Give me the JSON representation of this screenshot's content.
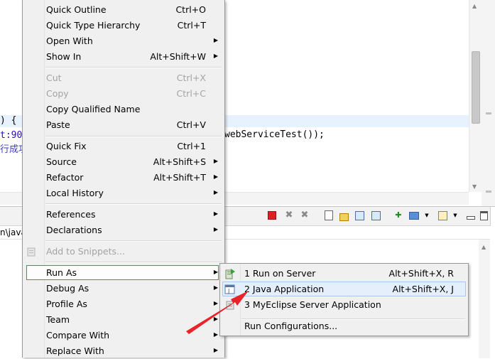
{
  "editor": {
    "code_lines": [
      {
        "text": ") {",
        "color": "#000000"
      },
      {
        "text": "t:90",
        "color": "#2a00ff"
      },
      {
        "text": "行成功",
        "color": "#3f3fbf"
      },
      {
        "text": "webServiceTest());",
        "color": "#000000"
      }
    ]
  },
  "console": {
    "path_text": "n\\java"
  },
  "context_menu": {
    "items": [
      {
        "label": "Quick Outline",
        "shortcut": "Ctrl+O",
        "submenu": false,
        "enabled": true
      },
      {
        "label": "Quick Type Hierarchy",
        "shortcut": "Ctrl+T",
        "submenu": false,
        "enabled": true
      },
      {
        "label": "Open With",
        "shortcut": "",
        "submenu": true,
        "enabled": true
      },
      {
        "label": "Show In",
        "shortcut": "Alt+Shift+W",
        "submenu": true,
        "enabled": true
      },
      {
        "label": "Cut",
        "shortcut": "Ctrl+X",
        "submenu": false,
        "enabled": false
      },
      {
        "label": "Copy",
        "shortcut": "Ctrl+C",
        "submenu": false,
        "enabled": false
      },
      {
        "label": "Copy Qualified Name",
        "shortcut": "",
        "submenu": false,
        "enabled": true
      },
      {
        "label": "Paste",
        "shortcut": "Ctrl+V",
        "submenu": false,
        "enabled": true
      },
      {
        "label": "Quick Fix",
        "shortcut": "Ctrl+1",
        "submenu": false,
        "enabled": true
      },
      {
        "label": "Source",
        "shortcut": "Alt+Shift+S",
        "submenu": true,
        "enabled": true
      },
      {
        "label": "Refactor",
        "shortcut": "Alt+Shift+T",
        "submenu": true,
        "enabled": true
      },
      {
        "label": "Local History",
        "shortcut": "",
        "submenu": true,
        "enabled": true
      },
      {
        "label": "References",
        "shortcut": "",
        "submenu": true,
        "enabled": true
      },
      {
        "label": "Declarations",
        "shortcut": "",
        "submenu": true,
        "enabled": true
      },
      {
        "label": "Add to Snippets...",
        "shortcut": "",
        "submenu": false,
        "enabled": false,
        "icon": "snippet-icon"
      },
      {
        "label": "Run As",
        "shortcut": "",
        "submenu": true,
        "enabled": true,
        "highlighted": true
      },
      {
        "label": "Debug As",
        "shortcut": "",
        "submenu": true,
        "enabled": true
      },
      {
        "label": "Profile As",
        "shortcut": "",
        "submenu": true,
        "enabled": true
      },
      {
        "label": "Team",
        "shortcut": "",
        "submenu": true,
        "enabled": true
      },
      {
        "label": "Compare With",
        "shortcut": "",
        "submenu": true,
        "enabled": true
      },
      {
        "label": "Replace With",
        "shortcut": "",
        "submenu": true,
        "enabled": true
      }
    ]
  },
  "run_as_submenu": {
    "items": [
      {
        "label": "1 Run on Server",
        "shortcut": "Alt+Shift+X, R",
        "icon": "run-on-server-icon"
      },
      {
        "label": "2 Java Application",
        "shortcut": "Alt+Shift+X, J",
        "icon": "java-application-icon",
        "active": true
      },
      {
        "label": "3 MyEclipse Server Application",
        "shortcut": "",
        "icon": "myeclipse-server-icon"
      },
      {
        "label": "Run Configurations...",
        "shortcut": ""
      }
    ]
  },
  "annotation": {
    "arrow_color": "#e8232a"
  }
}
